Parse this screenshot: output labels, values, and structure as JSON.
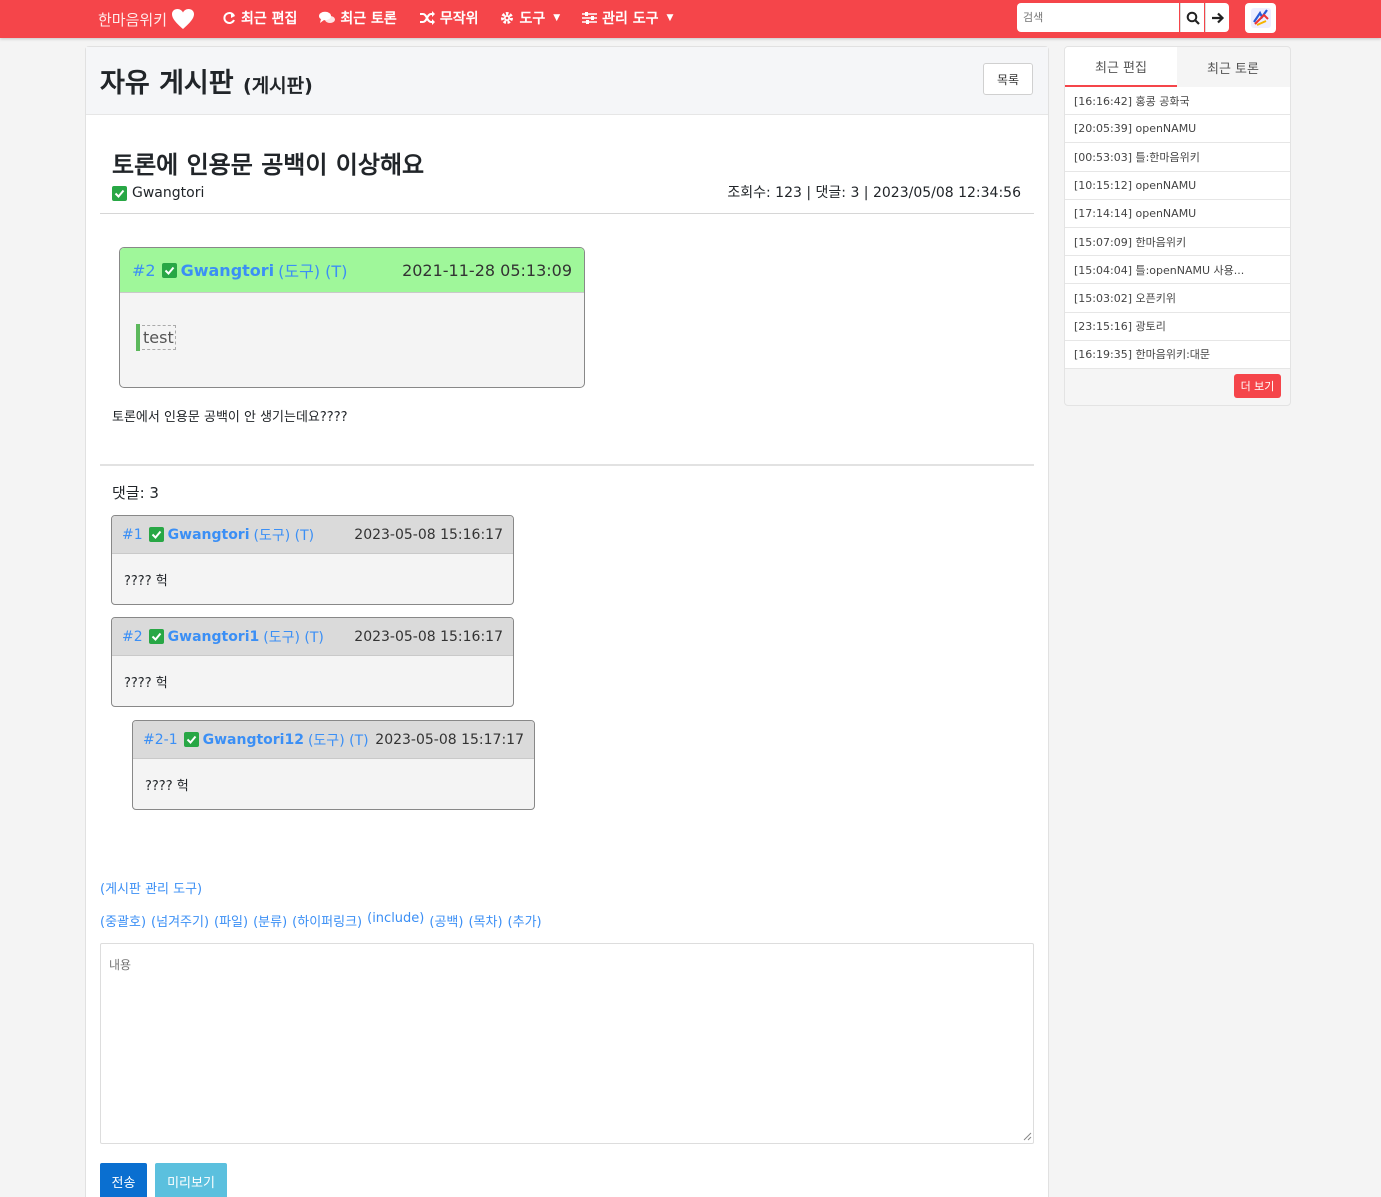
{
  "nav": {
    "brand": "한마음위키",
    "items": [
      {
        "label": "최근 편집",
        "icon": "refresh-icon"
      },
      {
        "label": "최근 토론",
        "icon": "comments-icon"
      },
      {
        "label": "무작위",
        "icon": "shuffle-icon"
      },
      {
        "label": "도구",
        "icon": "gear-icon",
        "caret": true
      },
      {
        "label": "관리 도구",
        "icon": "sliders-icon",
        "caret": true
      }
    ],
    "search_placeholder": "검색"
  },
  "board": {
    "title": "자유 게시판",
    "subtitle": "(게시판)",
    "list_button": "목록"
  },
  "post": {
    "title": "토론에 인용문 공백이 이상해요",
    "author": "Gwangtori",
    "meta": "조회수: 123  |  댓글: 3  |  2023/05/08 12:34:56",
    "quote": {
      "num": "#2",
      "user": "Gwangtori",
      "tools": "(도구) (T)",
      "date": "2021-11-28 05:13:09",
      "content": "test"
    },
    "body": "토론에서 인용문 공백이 안 생기는데요????"
  },
  "comments": {
    "count_label": "댓글: 3",
    "items": [
      {
        "num": "#1",
        "user": "Gwangtori",
        "tools": "(도구) (T)",
        "date": "2023-05-08 15:16:17",
        "body": "???? 헉"
      },
      {
        "num": "#2",
        "user": "Gwangtori1",
        "tools": "(도구) (T)",
        "date": "2023-05-08 15:16:17",
        "body": "???? 헉"
      },
      {
        "num": "#2-1",
        "user": "Gwangtori12",
        "tools": "(도구) (T)",
        "date": "2023-05-08 15:17:17",
        "body": "???? 헉"
      }
    ]
  },
  "editor": {
    "admin_link": "(게시판 관리 도구)",
    "tools": [
      "(중괄호)",
      "(넘겨주기)",
      "(파일)",
      "(분류)",
      "(하이퍼링크)",
      "(include)",
      "(공백)",
      "(목차)",
      "(추가)"
    ],
    "placeholder": "내용",
    "send": "전송",
    "preview": "미리보기"
  },
  "sidebar": {
    "tabs": [
      "최근 편집",
      "최근 토론"
    ],
    "items": [
      "[16:16:42] 홍콩 공화국",
      "[20:05:39] openNAMU",
      "[00:53:03] 틀:한마음위키",
      "[10:15:12] openNAMU",
      "[17:14:14] openNAMU",
      "[15:07:09] 한마음위키",
      "[15:04:04] 틀:openNAMU 사용...",
      "[15:03:02] 오픈키위",
      "[23:15:16] 광토리",
      "[16:19:35] 한마음위키:대문"
    ],
    "more": "더 보기"
  },
  "colors": {
    "accent": "#f5454a",
    "link": "#3b8ff5",
    "quote_header": "#9ff79a",
    "primary_button": "#0a6fd0",
    "info_button": "#5bc0de"
  }
}
